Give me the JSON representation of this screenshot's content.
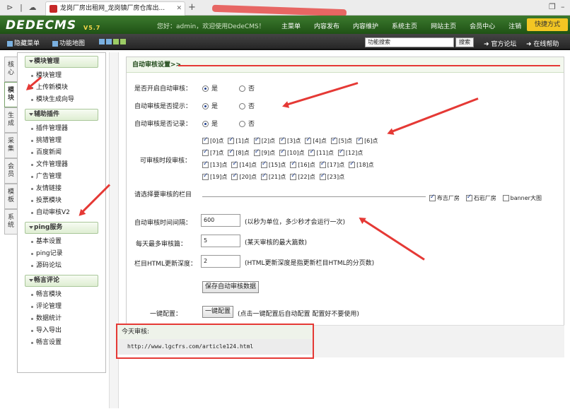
{
  "browser": {
    "tab_title": "龙岗厂房出租网_龙岗镇厂房仓库出...",
    "new_tab": "+"
  },
  "header": {
    "logo": "DEDECMS",
    "version": "V5.7",
    "welcome": "您好：admin，欢迎使用DedeCMS！",
    "menu": [
      "主菜单",
      "内容发布",
      "内容维护",
      "系统主页",
      "网站主页",
      "会员中心",
      "注销"
    ],
    "quick": "快捷方式"
  },
  "toolbar": {
    "hide_menu": "隐藏菜单",
    "func_map": "功能地图",
    "search_placeholder": "功能搜索",
    "search_btn": "搜索",
    "forum": "官方论坛",
    "help": "在线帮助"
  },
  "vtabs": [
    {
      "label": "核心"
    },
    {
      "label": "模块"
    },
    {
      "label": "生成"
    },
    {
      "label": "采集"
    },
    {
      "label": "会员"
    },
    {
      "label": "模板"
    },
    {
      "label": "系统"
    }
  ],
  "sidebar": {
    "groups": [
      {
        "title": "模块管理",
        "items": [
          "模块管理",
          "上传新模块",
          "模块生成向导"
        ]
      },
      {
        "title": "辅助插件",
        "items": [
          "插件管理器",
          "挑错管理",
          "百度新闻",
          "文件管理器",
          "广告管理",
          "友情链接",
          "投票模块",
          "自动审核V2"
        ]
      },
      {
        "title": "ping服务",
        "items": [
          "基本设置",
          "ping记录",
          "源码论坛"
        ]
      },
      {
        "title": "畅言评论",
        "items": [
          "畅言模块",
          "评论管理",
          "数据统计",
          "导入导出",
          "畅言设置"
        ]
      }
    ]
  },
  "main": {
    "title": "自动审核设置>>",
    "fields": {
      "enable": {
        "label": "是否开启自动审核：",
        "yes": "是",
        "no": "否"
      },
      "notify": {
        "label": "自动审核是否提示：",
        "yes": "是",
        "no": "否"
      },
      "record": {
        "label": "自动审核是否记录：",
        "yes": "是",
        "no": "否"
      }
    },
    "hours_label": "可审核时段审核：",
    "hours": [
      "[0]点",
      "[1]点",
      "[2]点",
      "[3]点",
      "[4]点",
      "[5]点",
      "[6]点",
      "[7]点",
      "[8]点",
      "[9]点",
      "[10]点",
      "[11]点",
      "[12]点",
      "[13]点",
      "[14]点",
      "[15]点",
      "[16]点",
      "[17]点",
      "[18]点",
      "[19]点",
      "[20]点",
      "[21]点",
      "[22]点",
      "[23]点"
    ],
    "columns_label": "请选择要审核的栏目",
    "columns": [
      "布吉厂房",
      "石岩厂房",
      "banner大图"
    ],
    "interval": {
      "label": "自动审核时间间隔：",
      "value": "600",
      "hint": "(以秒为单位，多少秒才会运行一次)"
    },
    "max": {
      "label": "每天最多审核篇：",
      "value": "5",
      "hint": "(某天审核的最大篇数)"
    },
    "depth": {
      "label": "栏目HTML更新深度：",
      "value": "2",
      "hint": "(HTML更新深度是指更新栏目HTML的分页数)"
    },
    "save_btn": "保存自动审核数据",
    "oneclick": {
      "label": "一键配置：",
      "btn": "一键配置",
      "hint": "(点击一键配置后自动配置 配置好不要使用)"
    }
  },
  "today": {
    "title": "今天审核:",
    "url": "http://www.lgcfrs.com/article124.html"
  }
}
